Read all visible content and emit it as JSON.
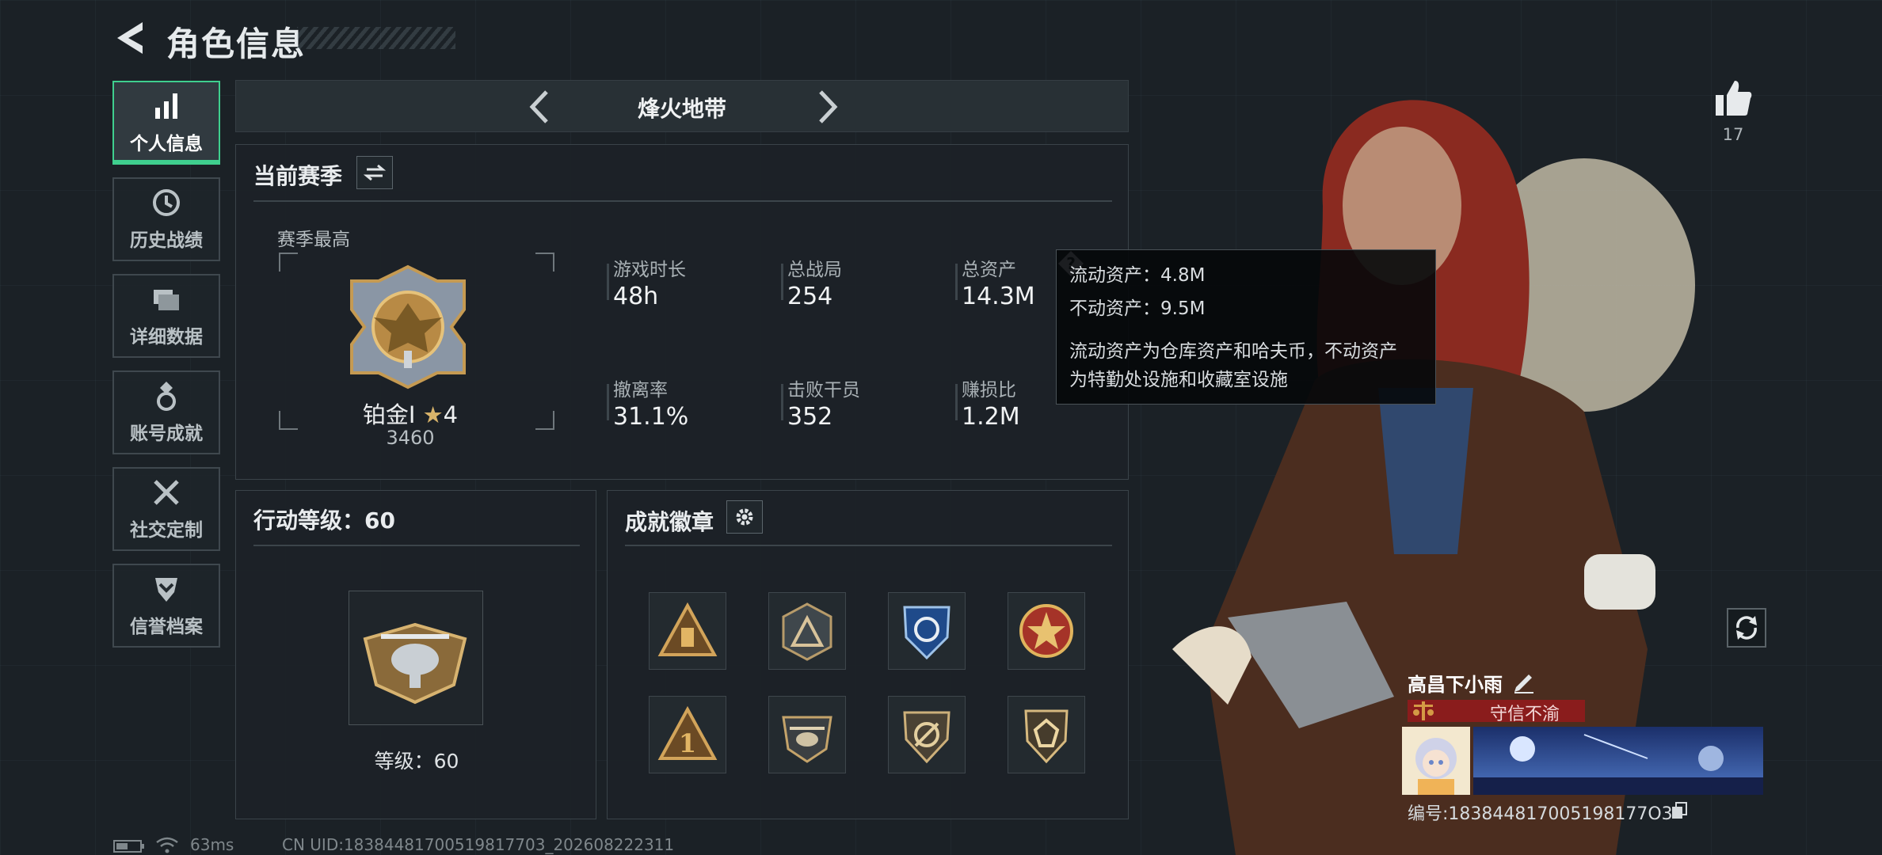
{
  "header": {
    "title": "角色信息"
  },
  "sidebar": {
    "items": [
      {
        "label": "个人信息",
        "icon": "bar-chart-icon",
        "active": true
      },
      {
        "label": "历史战绩",
        "icon": "history-clock-icon",
        "active": false
      },
      {
        "label": "详细数据",
        "icon": "data-folders-icon",
        "active": false
      },
      {
        "label": "账号成就",
        "icon": "achievement-medal-icon",
        "active": false
      },
      {
        "label": "社交定制",
        "icon": "tools-icon",
        "active": false
      },
      {
        "label": "信誉档案",
        "icon": "shield-chevron-icon",
        "active": false
      }
    ]
  },
  "mode": {
    "title": "烽火地带"
  },
  "season": {
    "title": "当前赛季",
    "best_label": "赛季最高",
    "rank_name": "铂金I",
    "rank_stars": "4",
    "rank_points": "3460",
    "stats": [
      {
        "label": "游戏时长",
        "value": "48h"
      },
      {
        "label": "总战局",
        "value": "254"
      },
      {
        "label": "总资产",
        "value": "14.3M"
      },
      {
        "label": "撤离率",
        "value": "31.1%"
      },
      {
        "label": "击败干员",
        "value": "352"
      },
      {
        "label": "赚损比",
        "value": "1.2M"
      }
    ]
  },
  "tooltip": {
    "liquid": "流动资产：4.8M",
    "fixed": "不动资产：9.5M",
    "desc_line1": "流动资产为仓库资产和哈夫币，不动资产",
    "desc_line2": "为特勤处设施和收藏室设施"
  },
  "action_level": {
    "title": "行动等级：60",
    "level_text": "等级：60"
  },
  "achievements": {
    "title": "成就徽章",
    "badges": [
      "triangle-gold-badge-icon",
      "triangle-dark-badge-icon",
      "shield-blue-badge-icon",
      "star-red-badge-icon",
      "triangle-one-badge-icon",
      "helicopter-badge-icon",
      "cross-shield-badge-icon",
      "gem-shield-badge-icon"
    ]
  },
  "profile": {
    "like_count": "17",
    "name": "高昌下小雨",
    "credit": "守信不渝",
    "uid_label": "编号:183844817005198177O3"
  },
  "footer": {
    "ping": "63ms",
    "uid": "CN UID:18384481700519817703_202608222311"
  },
  "colors": {
    "accent": "#3fcf8e",
    "credit": "#8a1c1c",
    "bg": "#1b2126"
  }
}
